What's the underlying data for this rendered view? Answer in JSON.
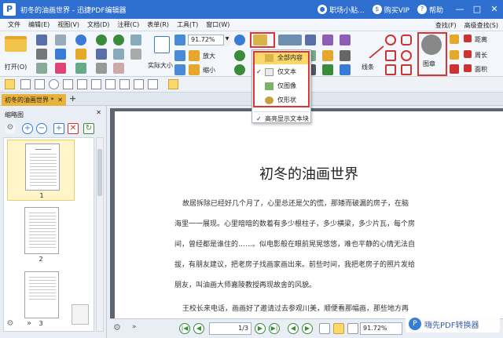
{
  "app": {
    "title": "初冬的油画世界 - 迅捷PDF编辑器",
    "logo": "P",
    "links": [
      {
        "label": "职场小贴..."
      },
      {
        "label": "购买VIP"
      },
      {
        "label": "帮助"
      }
    ],
    "window_buttons": [
      "—",
      "□",
      "✕"
    ]
  },
  "menu": {
    "items": [
      "文件",
      "编辑(E)",
      "视图(V)",
      "文档(D)",
      "注释(C)",
      "表单(R)",
      "工具(T)",
      "窗口(W)"
    ],
    "right": [
      "查找(F)",
      "高级查找(S)"
    ]
  },
  "ribbon": {
    "open_label": "打开(O)",
    "actual_size": "实际大小",
    "zoom_in": "放大",
    "zoom_out": "缩小",
    "zoom_value": "91.72%",
    "lines_label": "线条",
    "stamp_label": "图章",
    "distance": "距离",
    "perimeter": "周长",
    "area": "面积"
  },
  "dropdown": {
    "items": [
      {
        "label": "全部内容",
        "checked": false,
        "selected": true
      },
      {
        "label": "仅文本",
        "checked": true,
        "selected": false
      },
      {
        "label": "仅图像",
        "checked": false,
        "selected": false
      },
      {
        "label": "仅形状",
        "checked": false,
        "selected": false
      }
    ],
    "highlight": "高亮显示文本块"
  },
  "tabs": [
    {
      "label": "初冬的油画世界 *"
    }
  ],
  "sidebar": {
    "title": "缩略图",
    "pages": [
      "1",
      "2",
      "3"
    ]
  },
  "document": {
    "title": "初冬的油画世界",
    "paragraphs": [
      "故居拆除已经好几个月了，心里总还是欠的慌，那矮而破漏的房子，在脑",
      "海里一一展现。心里暗暗的数着有多少根柱子，多少横梁，多少片瓦，每个房",
      "间，曾经都是谁住的……。似电影般在眼前晃晃悠悠，难也平静的心情无法自",
      "拔，有朋友建议，把老房子找画家画出来。前些时间，我把老房子的照片发给",
      "朋友，叫油画大师嘉陵教授再现故舍的风貌。",
      "王校长来电话，画画好了邀请过去参观川美，顺便看那幅画，那些地方再"
    ]
  },
  "status": {
    "page": "1/3",
    "zoom": "91.72%"
  },
  "watermark": {
    "text": "嗨先PDF转换器"
  },
  "colors": {
    "titlebar": "#2f6fd0",
    "highlight": "#dd3333",
    "tab_active": "#e8b33a"
  }
}
